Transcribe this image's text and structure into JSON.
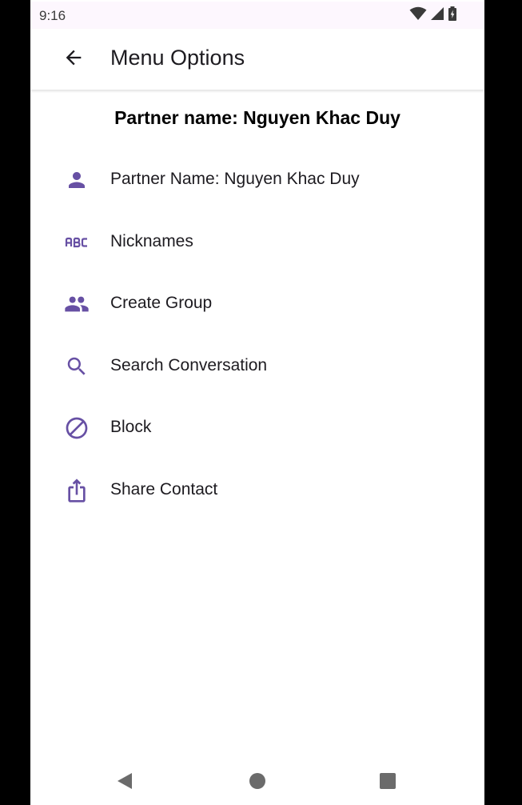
{
  "status_bar": {
    "time": "9:16",
    "icons": [
      "wifi-icon",
      "signal-icon",
      "battery-charging-icon"
    ]
  },
  "app_bar": {
    "title": "Menu Options",
    "back_icon": "arrow-back-icon"
  },
  "partner_header": "Partner name: Nguyen Khac Duy",
  "menu": {
    "items": [
      {
        "label": "Partner Name: Nguyen Khac Duy",
        "icon": "person-icon"
      },
      {
        "label": "Nicknames",
        "icon": "abc-icon"
      },
      {
        "label": "Create Group",
        "icon": "group-icon"
      },
      {
        "label": "Search Conversation",
        "icon": "search-icon"
      },
      {
        "label": "Block",
        "icon": "block-icon"
      },
      {
        "label": "Share Contact",
        "icon": "share-icon"
      }
    ]
  },
  "nav_bar": {
    "buttons": [
      "back-triangle-icon",
      "home-circle-icon",
      "recents-square-icon"
    ]
  },
  "colors": {
    "accent": "#6750a4",
    "status_bar_bg": "#fdf7fe",
    "text_primary": "#1d1b20",
    "nav_icon": "#6b6b6b",
    "frame": "#000000"
  }
}
